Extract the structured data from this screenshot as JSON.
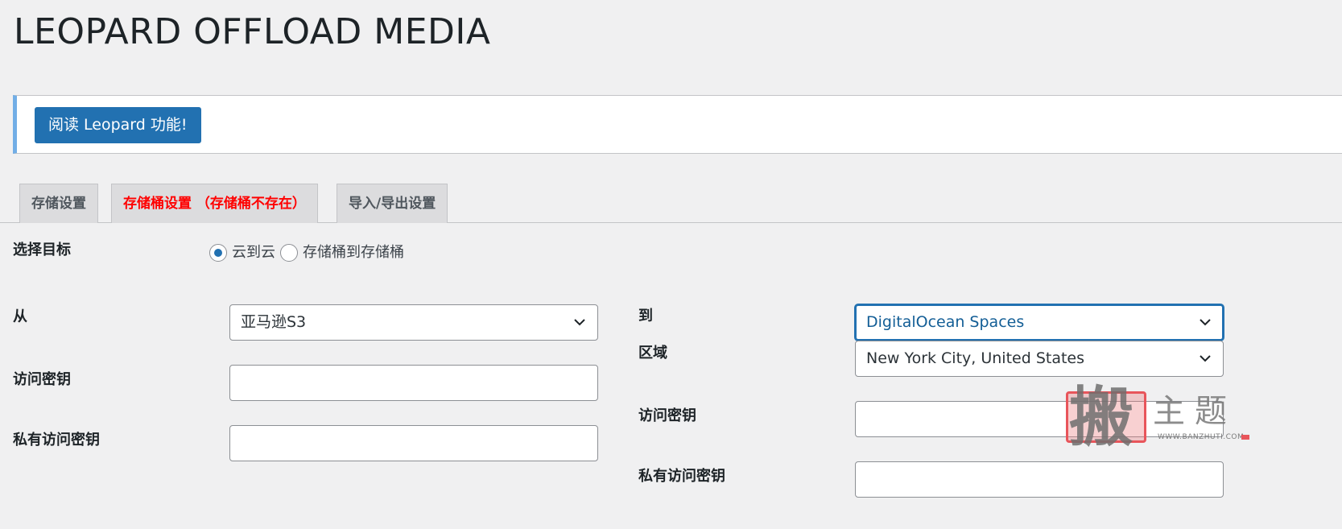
{
  "page": {
    "title": "LEOPARD OFFLOAD MEDIA"
  },
  "notice": {
    "button_label": "阅读 Leopard 功能!"
  },
  "tabs": [
    {
      "label": "存储设置",
      "active": false
    },
    {
      "label": "存储桶设置 （存储桶不存在）",
      "active": true
    },
    {
      "label": "导入/导出设置",
      "active": false
    }
  ],
  "target": {
    "label": "选择目标",
    "options": [
      {
        "label": "云到云",
        "checked": true
      },
      {
        "label": "存储桶到存储桶",
        "checked": false
      }
    ]
  },
  "source": {
    "label": "从",
    "provider_value": "亚马逊S3",
    "access_key_label": "访问密钥",
    "access_key_value": "",
    "secret_key_label": "私有访问密钥",
    "secret_key_value": ""
  },
  "destination": {
    "label": "到",
    "provider_value": "DigitalOcean Spaces",
    "region_label": "区域",
    "region_value": "New York City, United States",
    "access_key_label": "访问密钥",
    "access_key_value": "",
    "secret_key_label": "私有访问密钥",
    "secret_key_value": ""
  },
  "watermark": {
    "seal_char": "搬",
    "text": "主题",
    "url": "WWW.BANZHUTI.COM"
  },
  "colors": {
    "primary": "#2271b1",
    "notice_border": "#72aee6",
    "active_tab_text": "#ff0000",
    "background": "#f0f0f1"
  },
  "icons": {
    "select_arrow": "chevron-down-icon"
  }
}
